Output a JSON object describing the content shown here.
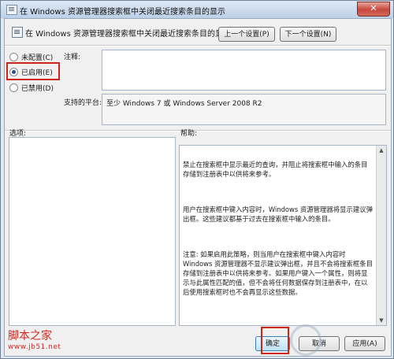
{
  "window": {
    "title": "在 Windows 资源管理器搜索框中关闭最近搜索条目的显示",
    "close_glyph": "✕"
  },
  "header": {
    "policy_title": "在 Windows 资源管理器搜索框中关闭最近搜索条目的显示",
    "prev_button": "上一个设置(P)",
    "next_button": "下一个设置(N)"
  },
  "state": {
    "options": [
      {
        "label": "未配置(C)",
        "checked": false
      },
      {
        "label": "已启用(E)",
        "checked": true
      },
      {
        "label": "已禁用(D)",
        "checked": false
      }
    ],
    "highlight_color": "#d0241b"
  },
  "comment": {
    "label": "注释:",
    "value": ""
  },
  "platform": {
    "label": "支持的平台:",
    "value": "至少 Windows 7 或 Windows Server 2008 R2"
  },
  "sections": {
    "options_label": "选项:",
    "help_label": "帮助:"
  },
  "help": {
    "p1": "禁止在搜索框中显示最近的查询，并阻止将搜索框中输入的条目存储到注册表中以供将来参考。",
    "p2": "用户在搜索框中键入内容时，Windows 资源管理器将显示建议弹出框。这些建议都基于过去在搜索框中输入的条目。",
    "p3": "注意: 如果启用此策略，则当用户在搜索框中键入内容时 Windows 资源管理器不显示建议弹出框，并且不会将搜索框条目存储到注册表中以供将来参考。如果用户键入一个属性，则将显示与此属性匹配的值，但不会将任何数据保存到注册表中，在以后使用搜索框时也不会再显示这些数据。"
  },
  "footer": {
    "ok_button": "确定",
    "cancel_button": "取消",
    "apply_button": "应用(A)"
  },
  "watermarks": {
    "site_name": "脚本之家",
    "site_url": "www.jb51.net"
  }
}
